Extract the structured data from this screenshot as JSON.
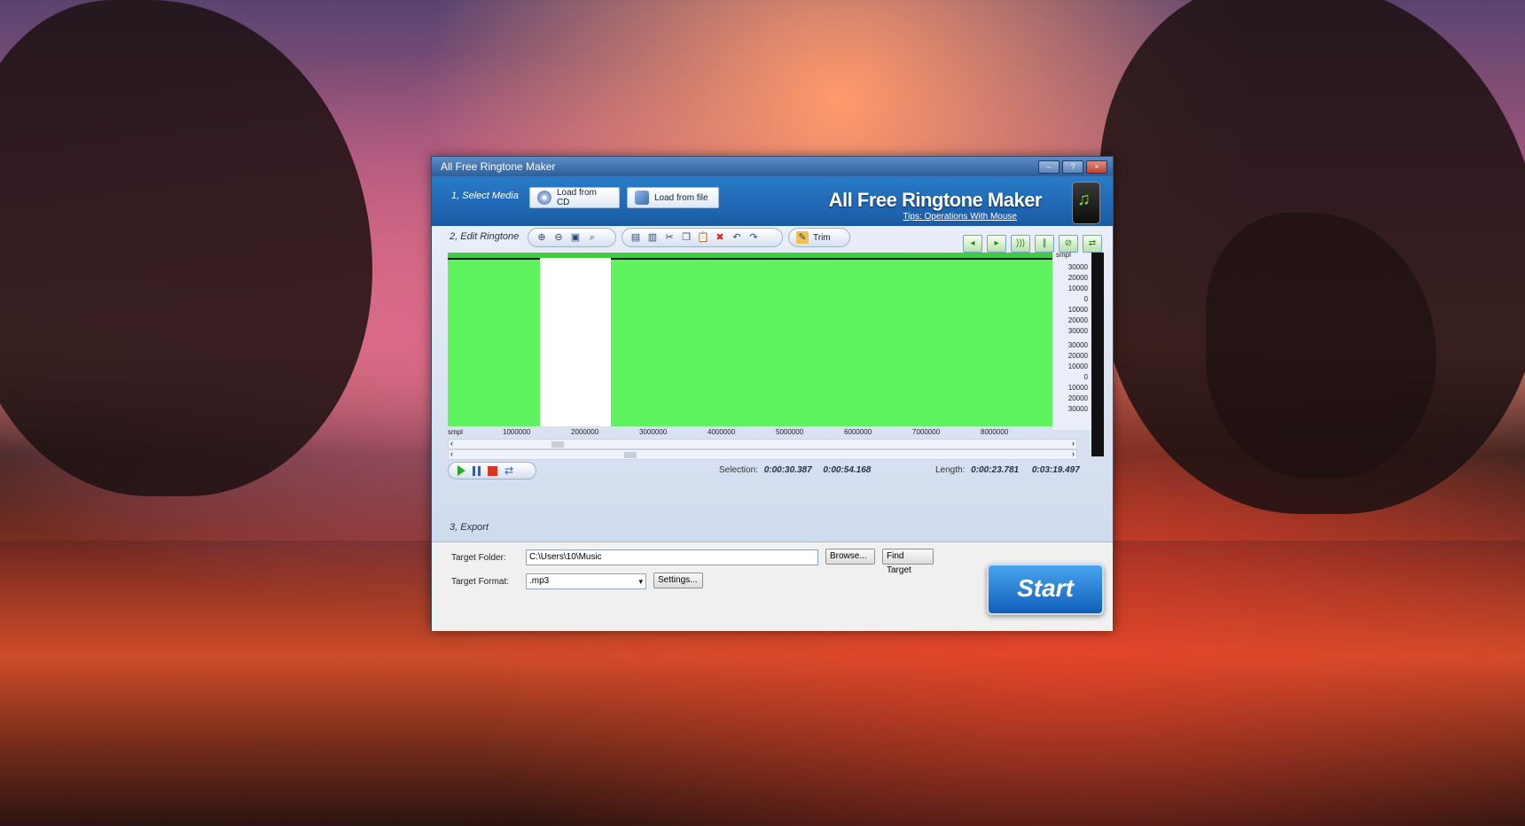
{
  "window": {
    "title": "All Free Ringtone Maker",
    "minimize": "–",
    "help": "?",
    "close": "×"
  },
  "select_media": {
    "label": "1, Select Media",
    "load_cd": "Load from CD",
    "load_file": "Load from file"
  },
  "brand": {
    "name": "All Free Ringtone Maker",
    "tips_link": "Tips: Operations With Mouse"
  },
  "edit": {
    "label": "2, Edit Ringtone",
    "trim": "Trim",
    "scale_unit": "smpl",
    "scale_top": [
      "30000",
      "20000",
      "10000",
      "0",
      "10000",
      "20000",
      "30000"
    ],
    "scale_bottom": [
      "30000",
      "20000",
      "10000",
      "0",
      "10000",
      "20000",
      "30000"
    ],
    "ruler_unit": "smpl",
    "ruler_ticks": [
      "1000000",
      "2000000",
      "3000000",
      "4000000",
      "5000000",
      "6000000",
      "7000000",
      "8000000"
    ]
  },
  "playback": {
    "selection_label": "Selection:",
    "selection_start": "0:00:30.387",
    "selection_end": "0:00:54.168",
    "length_label": "Length:",
    "length_value": "0:00:23.781",
    "total": "0:03:19.497"
  },
  "export": {
    "label": "3, Export",
    "target_folder_label": "Target Folder:",
    "target_folder_value": "C:\\Users\\10\\Music",
    "browse": "Browse...",
    "find_target": "Find Target",
    "target_format_label": "Target Format:",
    "target_format_value": ".mp3",
    "settings": "Settings...",
    "start": "Start"
  },
  "colors": {
    "waveform": "#5ff35f",
    "selection": "#ffffff",
    "header": "#1a5aa4"
  }
}
